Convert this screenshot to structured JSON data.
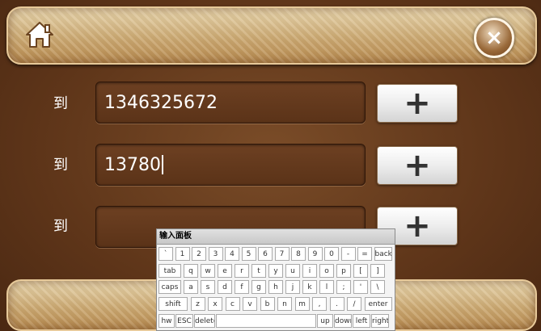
{
  "rows": [
    {
      "label": "到",
      "value": "1346325672",
      "plus": "+"
    },
    {
      "label": "到",
      "value": "13780",
      "plus": "+"
    },
    {
      "label": "到",
      "value": "",
      "plus": "+"
    }
  ],
  "close_label": "×",
  "keyboard": {
    "title": "输入面板",
    "row1": [
      "`",
      "1",
      "2",
      "3",
      "4",
      "5",
      "6",
      "7",
      "8",
      "9",
      "0",
      "-",
      "=",
      "back"
    ],
    "row2": [
      "tab",
      "q",
      "w",
      "e",
      "r",
      "t",
      "y",
      "u",
      "i",
      "o",
      "p",
      "[",
      "]"
    ],
    "row3": [
      "caps",
      "a",
      "s",
      "d",
      "f",
      "g",
      "h",
      "j",
      "k",
      "l",
      ";",
      "'",
      "\\"
    ],
    "row4": [
      "shift",
      "z",
      "x",
      "c",
      "v",
      "b",
      "n",
      "m",
      ",",
      ".",
      "/",
      "enter"
    ],
    "row5": [
      "hw",
      "ESC",
      "delete",
      "",
      "up",
      "down",
      "left",
      "right"
    ]
  }
}
